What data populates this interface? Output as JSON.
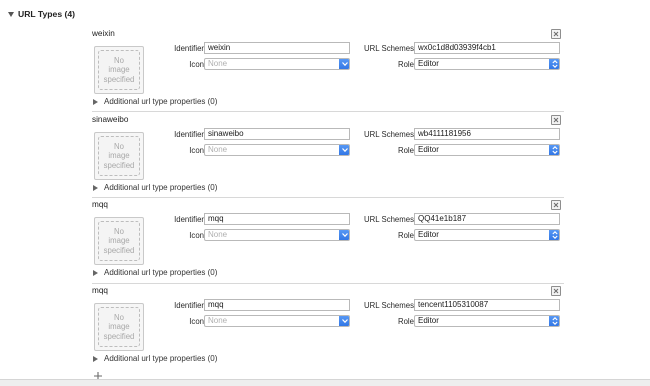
{
  "section": {
    "title": "URL Types (4)"
  },
  "labels": {
    "identifier": "Identifier",
    "icon": "Icon",
    "url_schemes": "URL Schemes",
    "role": "Role",
    "no_image": "No\nimage\nspecified",
    "additional": "Additional url type properties (0)"
  },
  "entries": [
    {
      "name": "weixin",
      "identifier": "weixin",
      "icon_placeholder": "None",
      "url_schemes": "wx0c1d8d03939f4cb1",
      "role": "Editor"
    },
    {
      "name": "sinaweibo",
      "identifier": "sinaweibo",
      "icon_placeholder": "None",
      "url_schemes": "wb4111181956",
      "role": "Editor"
    },
    {
      "name": "mqq",
      "identifier": "mqq",
      "icon_placeholder": "None",
      "url_schemes": "QQ41e1b187",
      "role": "Editor"
    },
    {
      "name": "mqq",
      "identifier": "mqq",
      "icon_placeholder": "None",
      "url_schemes": "tencent1105310087",
      "role": "Editor"
    }
  ],
  "colors": {
    "accent": "#3b82f0",
    "divider": "#d8d8d8",
    "placeholder": "#b0b0b0"
  },
  "icons": {
    "remove": "close-box-icon",
    "add": "plus-icon",
    "popup": "updown-chevron-icon",
    "dropdown": "chevron-down-icon"
  }
}
